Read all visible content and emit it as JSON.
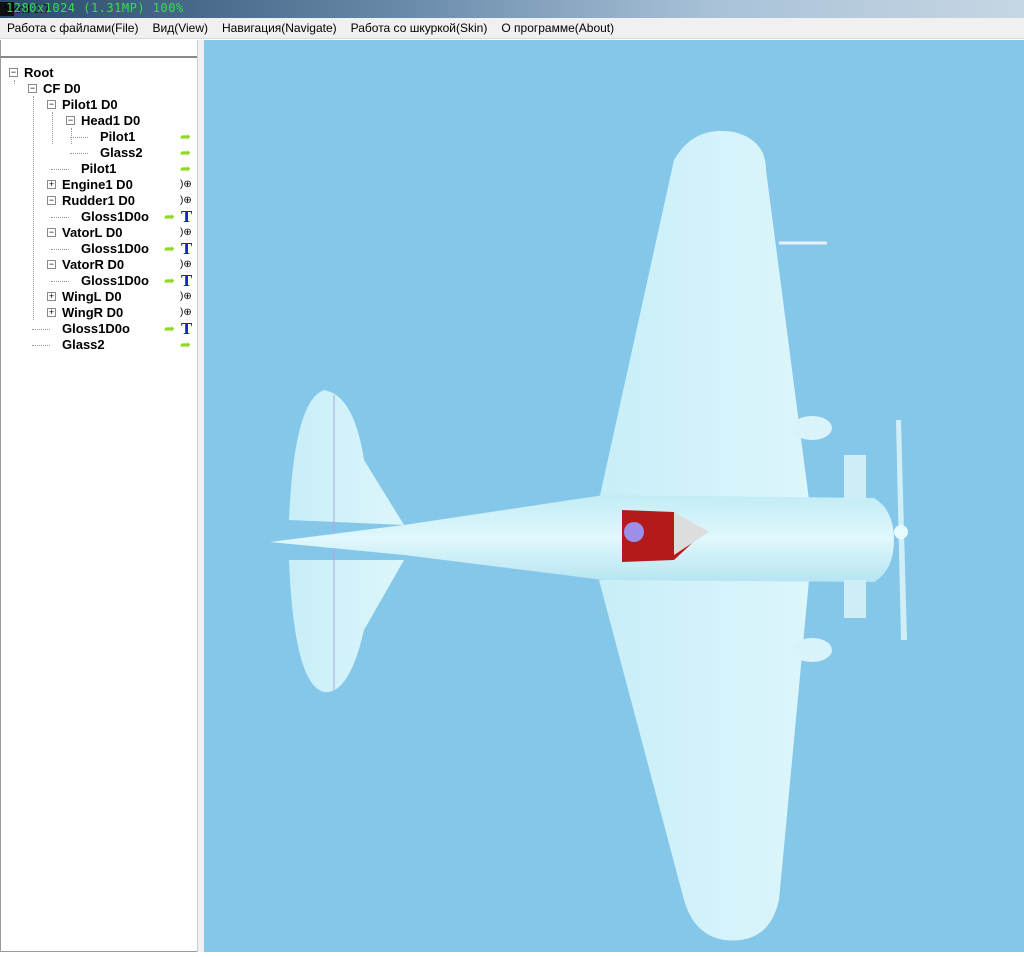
{
  "window": {
    "title": "Sknil 0.7",
    "overlay": "1280x1024 (1.31MP)  100%"
  },
  "menu": [
    "Работа с файлами(File)",
    "Вид(View)",
    "Навигация(Navigate)",
    "Работа со шкуркой(Skin)",
    "О программе(About)"
  ],
  "tree": [
    {
      "label": "Root",
      "level": 0,
      "expander": "minus",
      "icons": []
    },
    {
      "label": "CF  D0",
      "level": 1,
      "expander": "minus",
      "icons": []
    },
    {
      "label": "Pilot1  D0",
      "level": 2,
      "expander": "minus",
      "icons": []
    },
    {
      "label": "Head1  D0",
      "level": 3,
      "expander": "minus",
      "icons": []
    },
    {
      "label": "Pilot1",
      "level": 4,
      "expander": "none",
      "icons": [
        "arrow"
      ]
    },
    {
      "label": "Glass2",
      "level": 4,
      "expander": "none",
      "icons": [
        "arrow"
      ]
    },
    {
      "label": "Pilot1",
      "level": 3,
      "expander": "none",
      "icons": [
        "arrow"
      ]
    },
    {
      "label": "Engine1  D0",
      "level": 2,
      "expander": "plus",
      "icons": [
        "key"
      ]
    },
    {
      "label": "Rudder1  D0",
      "level": 2,
      "expander": "minus",
      "icons": [
        "key"
      ]
    },
    {
      "label": "Gloss1D0o",
      "level": 3,
      "expander": "none",
      "icons": [
        "arrow",
        "texture"
      ]
    },
    {
      "label": "VatorL  D0",
      "level": 2,
      "expander": "minus",
      "icons": [
        "key"
      ]
    },
    {
      "label": "Gloss1D0o",
      "level": 3,
      "expander": "none",
      "icons": [
        "arrow",
        "texture"
      ]
    },
    {
      "label": "VatorR  D0",
      "level": 2,
      "expander": "minus",
      "icons": [
        "key"
      ]
    },
    {
      "label": "Gloss1D0o",
      "level": 3,
      "expander": "none",
      "icons": [
        "arrow",
        "texture"
      ]
    },
    {
      "label": "WingL  D0",
      "level": 2,
      "expander": "plus",
      "icons": [
        "key"
      ]
    },
    {
      "label": "WingR  D0",
      "level": 2,
      "expander": "plus",
      "icons": [
        "key"
      ]
    },
    {
      "label": "Gloss1D0o",
      "level": 2,
      "expander": "none",
      "icons": [
        "arrow",
        "texture"
      ]
    },
    {
      "label": "Glass2",
      "level": 2,
      "expander": "none",
      "icons": [
        "arrow"
      ]
    }
  ],
  "icon_glyphs": {
    "texture": "T",
    "key": ")⊕"
  },
  "colors": {
    "sky": "#85c7e9",
    "plane": "#d2f1f8",
    "pilot": "#b01818"
  }
}
